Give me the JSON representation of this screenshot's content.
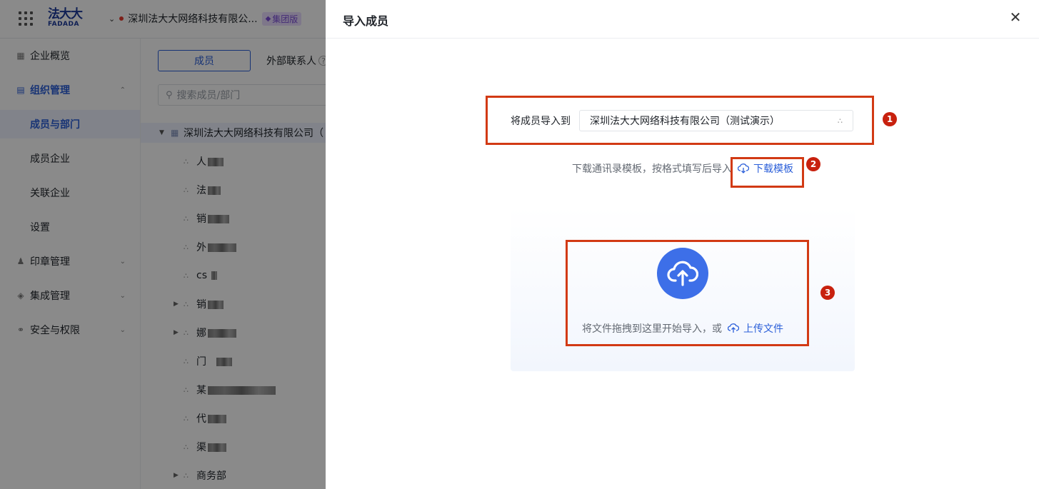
{
  "app": {
    "logo_cn": "法大大",
    "logo_en": "FADADA",
    "company": "深圳法大大网络科技有限公...",
    "edition_tag": "集团版"
  },
  "sidebar": {
    "items": [
      {
        "label": "企业概览"
      },
      {
        "label": "组织管理"
      },
      {
        "label": "成员与部门"
      },
      {
        "label": "成员企业"
      },
      {
        "label": "关联企业"
      },
      {
        "label": "设置"
      },
      {
        "label": "印章管理"
      },
      {
        "label": "集成管理"
      },
      {
        "label": "安全与权限"
      }
    ]
  },
  "main": {
    "tabs": [
      {
        "label": "成员"
      },
      {
        "label": "外部联系人"
      }
    ],
    "search_placeholder": "搜索成员/部门",
    "tree_root": "深圳法大大网络科技有限公司（",
    "tree_nodes": [
      {
        "label": "人"
      },
      {
        "label": "法"
      },
      {
        "label": "销"
      },
      {
        "label": "外"
      },
      {
        "label": "cs"
      },
      {
        "label": "销"
      },
      {
        "label": "娜"
      },
      {
        "label": "门"
      },
      {
        "label": "某"
      },
      {
        "label": "代"
      },
      {
        "label": "渠"
      },
      {
        "label": "商务部"
      }
    ]
  },
  "drawer": {
    "title": "导入成员",
    "import_to_label": "将成员导入到",
    "import_to_value": "深圳法大大网络科技有限公司（测试演示）",
    "template_hint": "下载通讯录模板，按格式填写后导入",
    "download_template": "下载模板",
    "drop_hint": "将文件拖拽到这里开始导入，或",
    "upload_file": "上传文件"
  },
  "annotations": {
    "badge_1": "1",
    "badge_2": "2",
    "badge_3": "3"
  },
  "colors": {
    "accent": "#2b5fd9",
    "highlight": "#d23a14",
    "upload_circle": "#3d6fe8"
  }
}
